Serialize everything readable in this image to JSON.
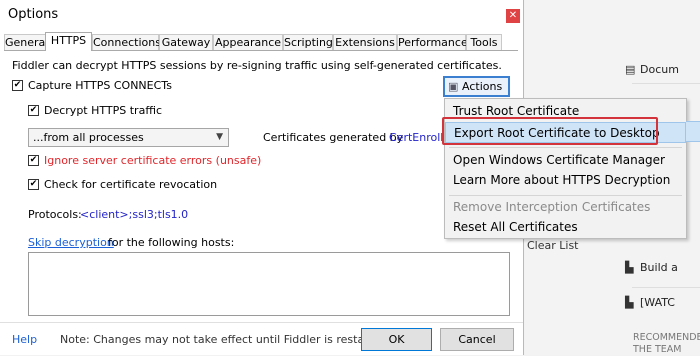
{
  "dialog": {
    "title": "Options",
    "close_glyph": "✕",
    "tabs": [
      "General",
      "HTTPS",
      "Connections",
      "Gateway",
      "Appearance",
      "Scripting",
      "Extensions",
      "Performance",
      "Tools"
    ],
    "active_tab": "HTTPS",
    "description": "Fiddler can decrypt HTTPS sessions by re-signing traffic using self-generated certificates.",
    "capture_https": "Capture HTTPS CONNECTs",
    "decrypt_https": "Decrypt HTTPS traffic",
    "process_filter": "...from all processes",
    "certs_label": "Certificates generated by",
    "certs_value": "CertEnroll",
    "ignore_errors": "Ignore server certificate errors (unsafe)",
    "check_revocation": "Check for certificate revocation",
    "protocols_label": "Protocols:",
    "protocols_value": "<client>;ssl3;tls1.0",
    "skip_link": "Skip decryption",
    "skip_rest": "for the following hosts:",
    "actions_button": "Actions",
    "help_link": "Help",
    "note": "Note: Changes may not take effect until Fiddler is restarted.",
    "ok_button": "OK",
    "cancel_button": "Cancel"
  },
  "actions_menu": {
    "items": [
      "Trust Root Certificate",
      "Export Root Certificate to Desktop",
      "Open Windows Certificate Manager",
      "Learn More about HTTPS Decryption",
      "Remove Interception Certificates",
      "Reset All Certificates"
    ],
    "highlighted_index": 1,
    "disabled_index": 4
  },
  "background": {
    "rows": [
      "Docum",
      "Build a",
      "[WATC"
    ],
    "clear_list": "Clear List",
    "recommend_line1": "RECOMMENDE",
    "recommend_line2": "THE TEAM"
  },
  "colors": {
    "accent": "#3a7fd0",
    "highlight_border": "#d3343c",
    "menu_highlight": "#cfe4f7",
    "error_text": "#e0262b",
    "link": "#1b5fd6"
  }
}
